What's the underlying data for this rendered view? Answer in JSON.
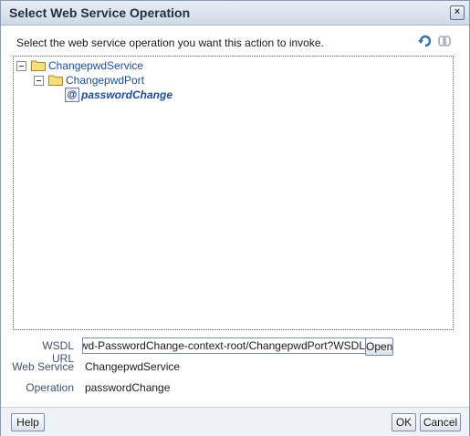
{
  "dialog": {
    "title": "Select Web Service Operation",
    "close_icon": "close-icon"
  },
  "instruction": "Select the web service operation you want this action to invoke.",
  "toolbar": {
    "refresh_icon": "refresh-icon",
    "link_icon": "link-icon"
  },
  "tree": {
    "service": {
      "label": "ChangepwdService",
      "expanded": true
    },
    "port": {
      "label": "ChangepwdPort",
      "expanded": true
    },
    "operation": {
      "label": "passwordChange",
      "icon": "@"
    }
  },
  "fields": {
    "wsdl_url_label": "WSDL URL",
    "wsdl_url_value": "ngepwd-PasswordChange-context-root/ChangepwdPort?WSDL",
    "open_label": "Open",
    "web_service_label": "Web Service",
    "web_service_value": "ChangepwdService",
    "operation_label": "Operation",
    "operation_value": "passwordChange"
  },
  "buttons": {
    "help": "Help",
    "ok": "OK",
    "cancel": "Cancel"
  }
}
